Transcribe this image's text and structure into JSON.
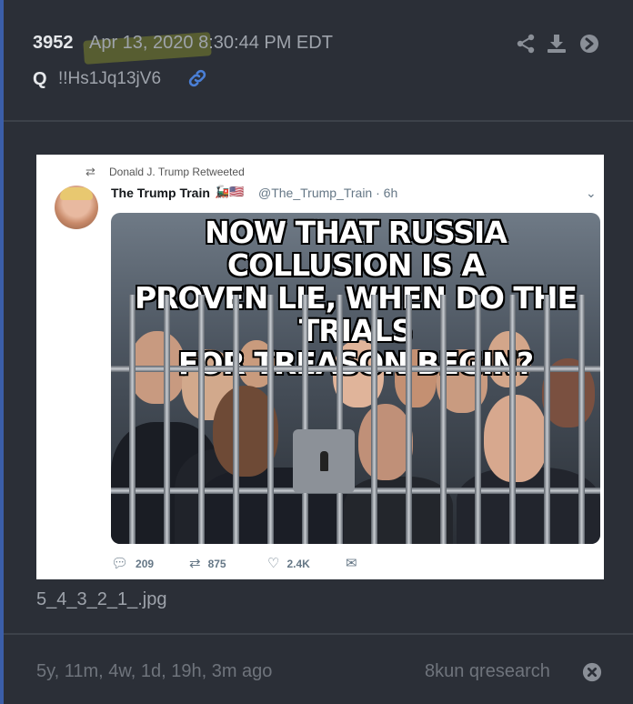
{
  "post": {
    "number": "3952",
    "date": "Apr 13, 2020 8:30:44 PM EDT",
    "author": "Q",
    "tripcode": "!!Hs1Jq13jV6"
  },
  "header_icons": [
    "share-icon",
    "download-icon",
    "forward-icon"
  ],
  "tweet": {
    "retweeted_by": "Donald J. Trump Retweeted",
    "name": "The Trump Train",
    "flags": "🚂🇺🇸",
    "handle_time": "@The_Trump_Train · 6h",
    "meme_caption": [
      "NOW THAT RUSSIA COLLUSION IS A",
      "PROVEN LIE, WHEN DO THE TRIALS",
      "FOR TREASON BEGIN?"
    ],
    "replies": "209",
    "retweets": "875",
    "likes": "2.4K"
  },
  "attachment": {
    "filename": "5_4_3_2_1_.jpg"
  },
  "footer": {
    "relative_time": "5y, 11m, 4w, 1d, 19h, 3m ago",
    "source": "8kun qresearch"
  },
  "colors": {
    "background": "#2b2f37",
    "accent": "#3b5ea8",
    "link": "#4a7fd6",
    "highlight": "#aab428"
  }
}
